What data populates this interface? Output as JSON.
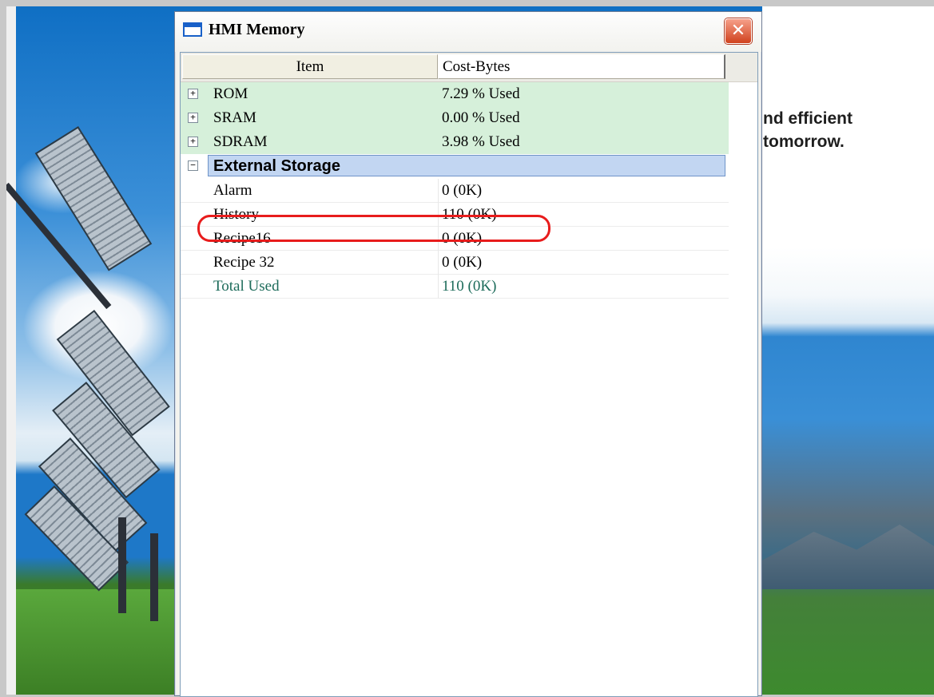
{
  "window": {
    "title": "HMI Memory",
    "close_icon": "close-icon"
  },
  "background": {
    "tagline_line1": "nd efficient",
    "tagline_line2": "tomorrow."
  },
  "table": {
    "columns": [
      "Item",
      "Cost-Bytes"
    ],
    "groups": [
      {
        "label": "ROM",
        "value": "7.29 % Used",
        "expander": "+"
      },
      {
        "label": "SRAM",
        "value": "0.00 % Used",
        "expander": "+"
      },
      {
        "label": "SDRAM",
        "value": "3.98 % Used",
        "expander": "+"
      }
    ],
    "expanded_group": {
      "label": "External Storage",
      "expander": "−"
    },
    "children": [
      {
        "label": "Alarm",
        "value": "0 (0K)"
      },
      {
        "label": "History",
        "value": "110 (0K)"
      },
      {
        "label": "Recipe16",
        "value": "0 (0K)"
      },
      {
        "label": "Recipe 32",
        "value": "0 (0K)"
      }
    ],
    "total": {
      "label": "Total Used",
      "value": "110 (0K)"
    }
  },
  "colors": {
    "group_row_bg": "#d6f0da",
    "selection_bg": "#c2d6f2",
    "total_text": "#1c6b5a",
    "annotation": "#e81c1c"
  }
}
